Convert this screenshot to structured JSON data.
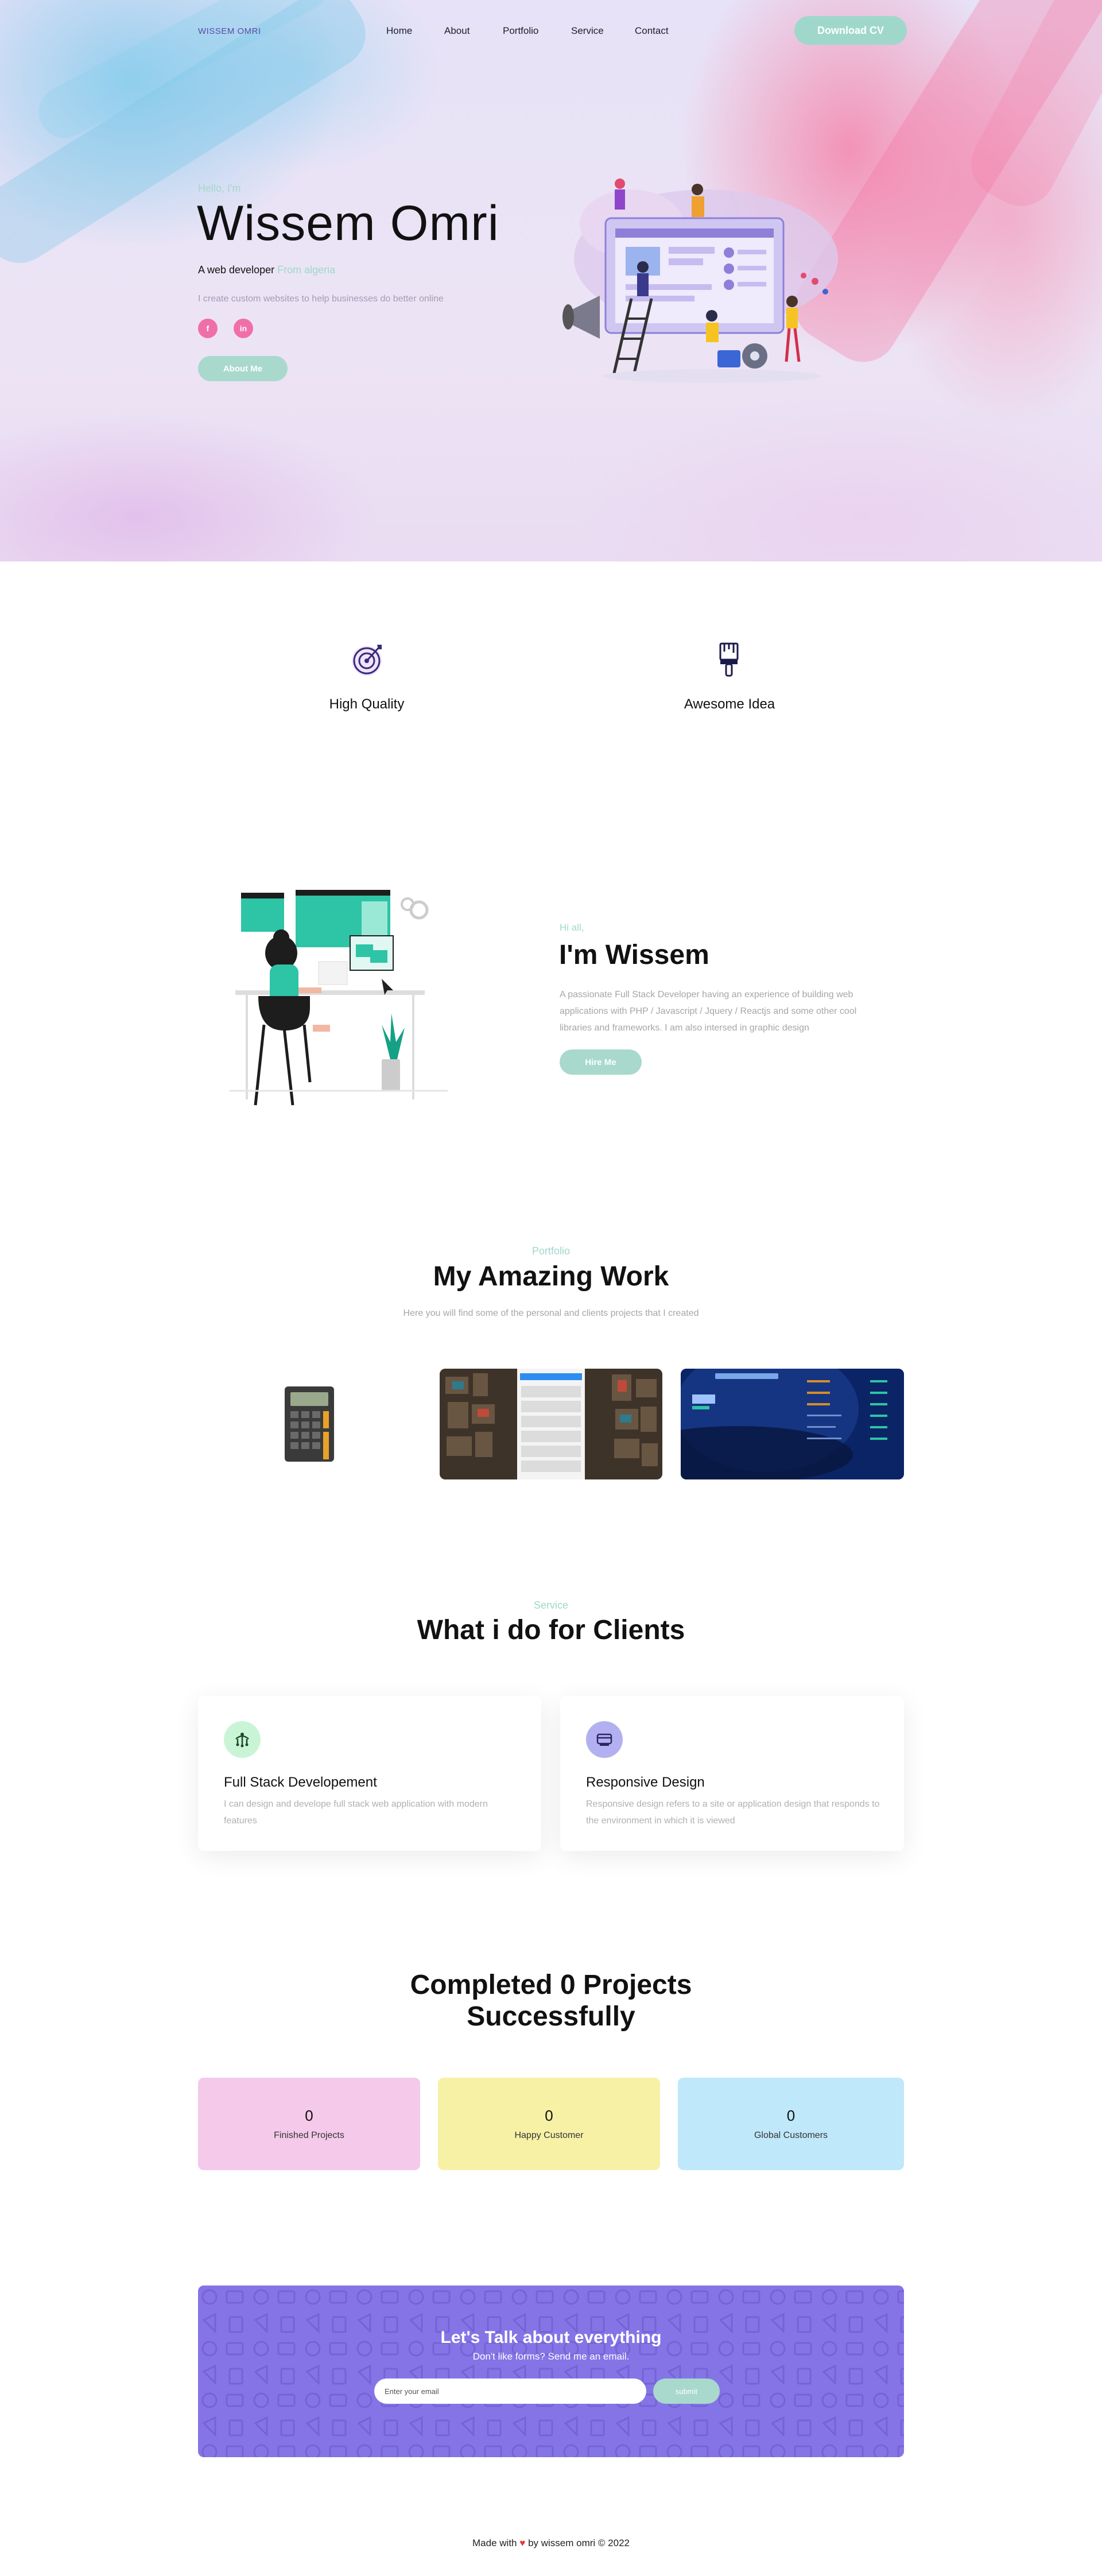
{
  "nav": {
    "logo": "WISSEM OMRI",
    "items": [
      "Home",
      "About",
      "Portfolio",
      "Service",
      "Contact"
    ],
    "cta": "Download CV"
  },
  "hero": {
    "greeting": "Hello, I'm",
    "name": "Wissem Omri",
    "role_prefix": "A web developer",
    "role_place": "From algeria",
    "description": "I create custom websites to help businesses do better online",
    "socials": [
      "f",
      "in"
    ],
    "button": "About Me"
  },
  "features": [
    {
      "label": "High Quality",
      "icon": "target-icon"
    },
    {
      "label": "Awesome Idea",
      "icon": "paint-brush-icon"
    }
  ],
  "about": {
    "kicker": "Hi all,",
    "title": "I'm Wissem",
    "text": "A passionate Full Stack Developer having an experience of building web applications with PHP / Javascript / Jquery / Reactjs and some other cool libraries and frameworks. I am also intersed in graphic design",
    "button": "Hire Me"
  },
  "portfolio": {
    "kicker": "Portfolio",
    "title": "My Amazing Work",
    "subtitle": "Here you will find some of the personal and clients projects that I created"
  },
  "service": {
    "kicker": "Service",
    "title": "What i do for Clients",
    "cards": [
      {
        "title": "Full Stack Developement",
        "desc": "I can design and develope full stack web application with modern features",
        "icon": "code-branch-icon",
        "icon_bg": "#c9f5d6"
      },
      {
        "title": "Responsive Design",
        "desc": "Responsive design refers to a site or application design that responds to the environment in which it is viewed",
        "icon": "layers-icon",
        "icon_bg": "#b3b0f2"
      }
    ]
  },
  "stats": {
    "title_line1": "Completed 0 Projects",
    "title_line2": "Successfully",
    "items": [
      {
        "value": "0",
        "label": "Finished Projects",
        "color": "#f4c9ea"
      },
      {
        "value": "0",
        "label": "Happy Customer",
        "color": "#f7f1a6"
      },
      {
        "value": "0",
        "label": "Global Customers",
        "color": "#bfe8fa"
      }
    ]
  },
  "contact": {
    "title": "Let's Talk about everything",
    "subtitle": "Don't like forms? Send me an email.",
    "placeholder": "Enter your email",
    "button": "submit"
  },
  "footer": {
    "before": "Made with",
    "heart": "♥",
    "after": "by wissem omri © 2022"
  },
  "colors": {
    "accent": "#9fd8cb",
    "pink": "#f06fa9",
    "contact_bg": "#8574e6"
  }
}
